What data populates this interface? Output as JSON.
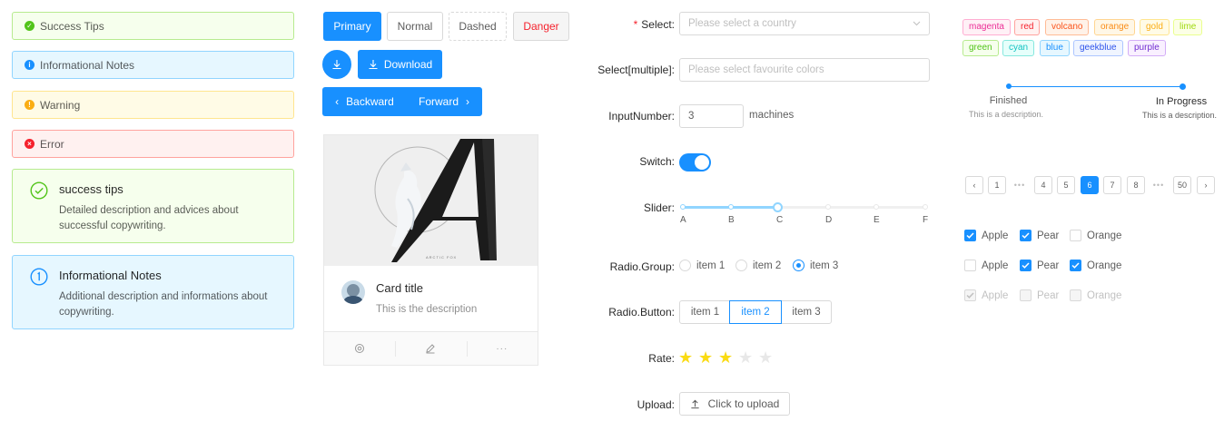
{
  "alerts": {
    "success": "Success Tips",
    "info": "Informational Notes",
    "warning": "Warning",
    "error": "Error",
    "success_big": {
      "title": "success tips",
      "desc1": "Detailed description and advices about",
      "desc2": "successful copywriting."
    },
    "info_big": {
      "title": "Informational Notes",
      "desc1": "Additional description and informations about",
      "desc2": "copywriting."
    }
  },
  "buttons": {
    "primary": "Primary",
    "normal": "Normal",
    "dashed": "Dashed",
    "danger": "Danger",
    "download": "Download",
    "backward": "Backward",
    "forward": "Forward"
  },
  "card": {
    "title": "Card title",
    "description": "This is the description",
    "cover_caption": "ARCTIC FOX"
  },
  "form": {
    "select_label": "Select",
    "select_placeholder": "Please select a country",
    "multi_label": "Select[multiple]",
    "multi_placeholder": "Please select favourite colors",
    "input_number_label": "InputNumber",
    "input_number_value": "3",
    "input_number_suffix": "machines",
    "switch_label": "Switch",
    "switch_on": true,
    "slider_label": "Slider",
    "slider_marks": [
      "A",
      "B",
      "C",
      "D",
      "E",
      "F"
    ],
    "slider_value_index": 2,
    "radio_group_label": "Radio.Group",
    "radio_items": [
      "item 1",
      "item 2",
      "item 3"
    ],
    "radio_selected": "item 3",
    "radio_button_label": "Radio.Button",
    "radio_button_items": [
      "item 1",
      "item 2",
      "item 3"
    ],
    "radio_button_selected": "item 2",
    "rate_label": "Rate",
    "rate_value": 3,
    "rate_max": 5,
    "upload_label": "Upload",
    "upload_button": "Click to upload",
    "colon": ":"
  },
  "tags": [
    "magenta",
    "red",
    "volcano",
    "orange",
    "gold",
    "lime",
    "green",
    "cyan",
    "blue",
    "geekblue",
    "purple"
  ],
  "steps": [
    {
      "title": "Finished",
      "desc": "This is a description."
    },
    {
      "title": "In Progress",
      "desc": "This is a description."
    }
  ],
  "pagination": {
    "pages": [
      "1",
      "4",
      "5",
      "6",
      "7",
      "8",
      "50"
    ],
    "current": "6",
    "ellipsis": "•••"
  },
  "checkboxes": {
    "row1": [
      {
        "label": "Apple",
        "checked": true
      },
      {
        "label": "Pear",
        "checked": true
      },
      {
        "label": "Orange",
        "checked": false
      }
    ],
    "row2": [
      {
        "label": "Apple",
        "checked": false
      },
      {
        "label": "Pear",
        "checked": true
      },
      {
        "label": "Orange",
        "checked": true
      }
    ],
    "row3": [
      {
        "label": "Apple",
        "checked": true
      },
      {
        "label": "Pear",
        "checked": false
      },
      {
        "label": "Orange",
        "checked": false
      }
    ]
  },
  "colors": {
    "primary": "#1890ff",
    "star": "#fadb14",
    "star_empty": "#e8e8e8",
    "required": "#f5222d"
  }
}
